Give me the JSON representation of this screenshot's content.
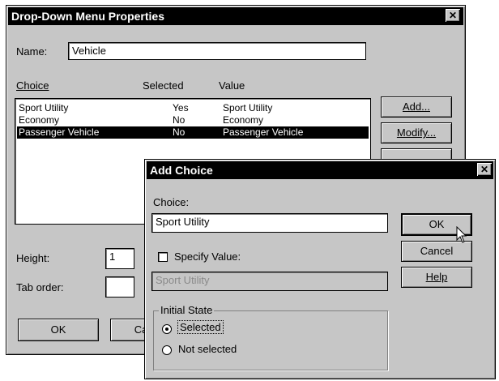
{
  "main_dialog": {
    "title": "Drop-Down Menu Properties",
    "close_glyph": "✕",
    "name_label": "Name:",
    "name_value": "Vehicle",
    "columns": {
      "choice": "Choice",
      "selected": "Selected",
      "value": "Value"
    },
    "rows": [
      {
        "choice": "Sport Utility",
        "selected": "Yes",
        "value": "Sport Utility"
      },
      {
        "choice": "Economy",
        "selected": "No",
        "value": "Economy"
      },
      {
        "choice": "Passenger Vehicle",
        "selected": "No",
        "value": "Passenger Vehicle"
      }
    ],
    "add_button": "Add...",
    "modify_button": "Modify...",
    "height_label": "Height:",
    "height_value": "1",
    "tab_order_label": "Tab order:",
    "tab_order_value": "",
    "ok_button": "OK",
    "cancel_button": "Cancel"
  },
  "add_choice_dialog": {
    "title": "Add Choice",
    "close_glyph": "✕",
    "choice_label": "Choice:",
    "choice_value": "Sport Utility",
    "specify_value_label": "Specify Value:",
    "specify_value_checked": false,
    "value_field": "Sport Utility",
    "initial_state_label": "Initial State",
    "selected_option": "Selected",
    "not_selected_option": "Not selected",
    "ok_button": "OK",
    "cancel_button": "Cancel",
    "help_button": "Help"
  },
  "colors": {
    "dialog_face": "#c6c6c6",
    "titlebar": "#000000",
    "selection": "#000000"
  }
}
